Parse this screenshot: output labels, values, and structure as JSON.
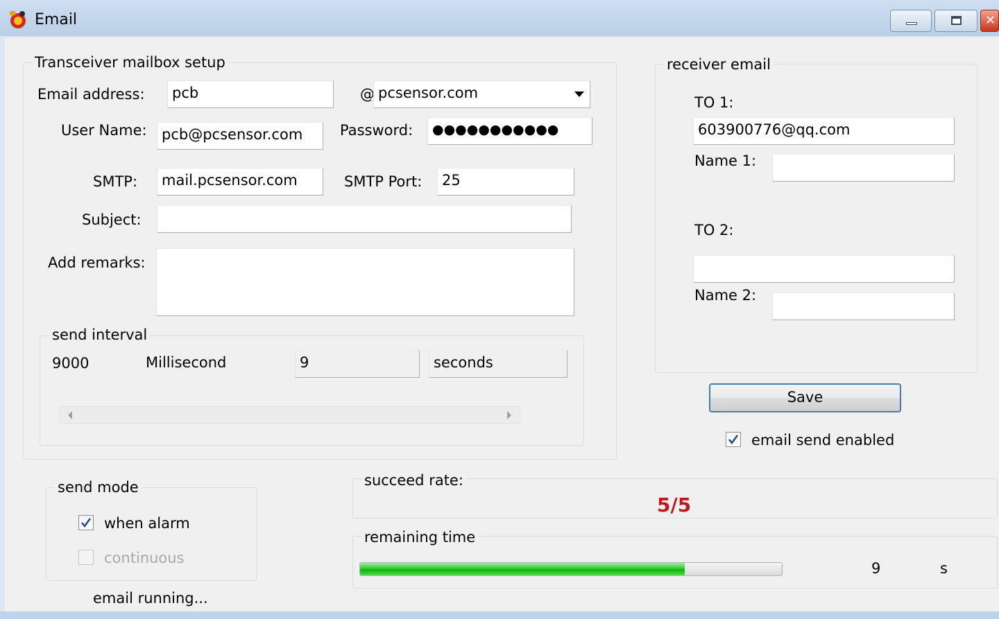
{
  "window": {
    "title": "Email",
    "icons": {
      "app": "app-icon",
      "minimize": "minimize-icon",
      "maximize": "maximize-icon",
      "close": "close-icon"
    }
  },
  "transceiver": {
    "group_label": "Transceiver mailbox setup",
    "email_address_label": "Email address:",
    "email_address_value": "pcb",
    "at_sign": "@",
    "domain_value": "pcsensor.com",
    "user_name_label": "User Name:",
    "user_name_value": "pcb@pcsensor.com",
    "password_label": "Password:",
    "password_value": "●●●●●●●●●●●",
    "smtp_label": "SMTP:",
    "smtp_value": "mail.pcsensor.com",
    "smtp_port_label": "SMTP Port:",
    "smtp_port_value": "25",
    "subject_label": "Subject:",
    "subject_value": "",
    "remarks_label": "Add remarks:",
    "remarks_value": ""
  },
  "interval": {
    "group_label": "send interval",
    "ms_value": "9000",
    "ms_unit": "Millisecond",
    "seconds_value": "9",
    "seconds_unit": "seconds",
    "slider_level": 0.0
  },
  "receiver": {
    "group_label": "receiver email",
    "to1_label": "TO 1:",
    "to1_value": "603900776@qq.com",
    "name1_label": "Name 1:",
    "name1_value": "",
    "to2_label": "TO 2:",
    "to2_value": "",
    "name2_label": "Name 2:",
    "name2_value": ""
  },
  "actions": {
    "save_label": "Save",
    "email_send_enabled_label": "email send enabled",
    "email_send_enabled_checked": true
  },
  "send_mode": {
    "group_label": "send mode",
    "when_alarm_label": "when alarm",
    "when_alarm_checked": true,
    "continuous_label": "continuous",
    "continuous_checked": false
  },
  "status": {
    "running_text": "email running...",
    "succeed_rate_label": "succeed rate:",
    "succeed_rate_value": "5/5",
    "succeed_rate_color": "#c0181e",
    "remaining_label": "remaining time",
    "remaining_value": "9",
    "remaining_unit": "s",
    "remaining_progress": 0.77
  }
}
